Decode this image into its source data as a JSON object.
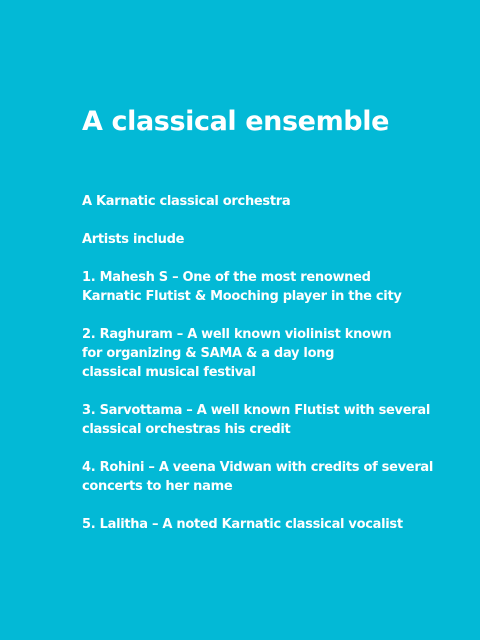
{
  "slide": {
    "title": "A classical ensemble",
    "subtitle": "A Karnatic classical orchestra",
    "intro": "Artists include",
    "artists": [
      {
        "lines": [
          "1. Mahesh S – One of the most renowned",
          "Karnatic Flutist & Mooching player in the city"
        ]
      },
      {
        "lines": [
          "2. Raghuram – A well known violinist known",
          "for organizing & SAMA & a day long",
          "classical musical festival"
        ]
      },
      {
        "lines": [
          "3. Sarvottama – A well known Flutist with several",
          "classical orchestras his credit"
        ]
      },
      {
        "lines": [
          "4. Rohini – A veena Vidwan with credits of several",
          "concerts to her name"
        ]
      },
      {
        "lines": [
          "5. Lalitha  – A noted Karnatic classical vocalist"
        ]
      }
    ]
  }
}
